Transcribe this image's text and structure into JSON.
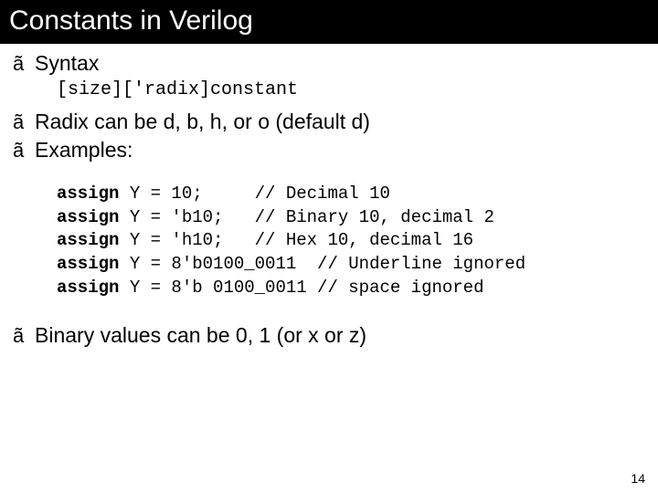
{
  "title": "Constants in Verilog",
  "bullets": {
    "b1": "Syntax",
    "b2": "Radix can be d, b, h, or o (default d)",
    "b3": "Examples:",
    "b4": "Binary values can be 0, 1 (or x or z)"
  },
  "syntax_line": "[size]['radix]constant",
  "code": {
    "kw": "assign",
    "l1_rest": " Y = 10;     // Decimal 10",
    "l2_rest": " Y = 'b10;   // Binary 10, decimal 2",
    "l3_rest": " Y = 'h10;   // Hex 10, decimal 16",
    "l4_rest": " Y = 8'b0100_0011  // Underline ignored",
    "l5_rest": " Y = 8'b 0100_0011 // space ignored"
  },
  "page_number": "14",
  "bullet_char": "ã"
}
